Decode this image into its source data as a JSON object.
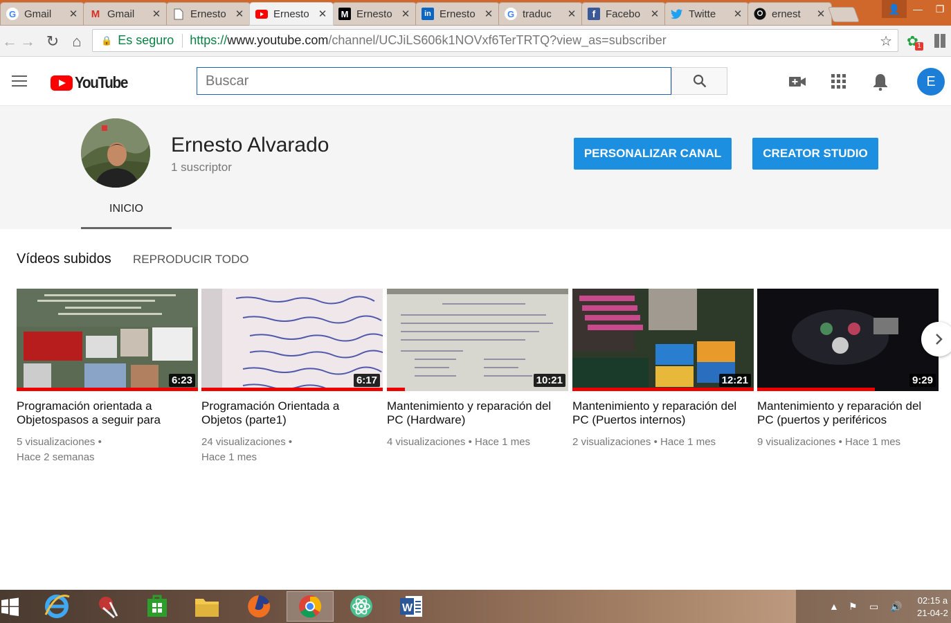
{
  "browser": {
    "tabs": [
      {
        "label": "Gmail",
        "icon": "google-icon"
      },
      {
        "label": "Gmail",
        "icon": "gmail-icon"
      },
      {
        "label": "Ernesto",
        "icon": "page-icon"
      },
      {
        "label": "Ernesto",
        "icon": "youtube-icon",
        "active": true
      },
      {
        "label": "Ernesto",
        "icon": "medium-icon"
      },
      {
        "label": "Ernesto",
        "icon": "linkedin-icon"
      },
      {
        "label": "traduc",
        "icon": "google-icon"
      },
      {
        "label": "Facebo",
        "icon": "facebook-icon"
      },
      {
        "label": "Twitte",
        "icon": "twitter-icon"
      },
      {
        "label": "ernest",
        "icon": "github-icon"
      }
    ],
    "address": {
      "secure_label": "Es seguro",
      "scheme": "https://",
      "host": "www.youtube.com",
      "path": "/channel/UCJiLS606k1NOVxf6TerTRTQ?view_as=subscriber"
    },
    "extension_badge": "1"
  },
  "youtube": {
    "logo_text": "YouTube",
    "search_placeholder": "Buscar",
    "account_initial": "E",
    "colors": {
      "brand_red": "#ff0000",
      "accent_blue": "#1d8fe1"
    }
  },
  "channel": {
    "name": "Ernesto Alvarado",
    "subscribers": "1 suscriptor",
    "customize_button": "PERSONALIZAR CANAL",
    "studio_button": "CREATOR STUDIO",
    "tabs": [
      {
        "label": "INICIO",
        "active": true
      }
    ]
  },
  "uploads": {
    "title": "Vídeos subidos",
    "play_all": "REPRODUCIR TODO",
    "videos": [
      {
        "title": "Programación orientada a Objetospasos a seguir para",
        "duration": "6:23",
        "views": "5 visualizaciones",
        "age": "Hace 2 semanas",
        "watched_fraction": 1.0
      },
      {
        "title": "Programación Orientada a Objetos (parte1)",
        "duration": "6:17",
        "views": "24 visualizaciones",
        "age": "Hace 1 mes",
        "watched_fraction": 1.0
      },
      {
        "title": "Mantenimiento y reparación del PC (Hardware)",
        "duration": "10:21",
        "views": "4 visualizaciones",
        "age": "Hace 1 mes",
        "watched_fraction": 0.1
      },
      {
        "title": "Mantenimiento y reparación del PC (Puertos internos)",
        "duration": "12:21",
        "views": "2 visualizaciones",
        "age": "Hace 1 mes",
        "watched_fraction": 1.0
      },
      {
        "title": "Mantenimiento y reparación del PC (puertos y periféricos",
        "duration": "9:29",
        "views": "9 visualizaciones",
        "age": "Hace 1 mes",
        "watched_fraction": 0.65
      }
    ]
  },
  "taskbar": {
    "apps": [
      "internet-explorer-icon",
      "snipping-tool-icon",
      "store-icon",
      "file-explorer-icon",
      "firefox-icon",
      "chrome-icon",
      "atom-icon",
      "word-icon"
    ],
    "active_app": "chrome-icon",
    "time": "02:15 a",
    "date": "21-04-2"
  }
}
